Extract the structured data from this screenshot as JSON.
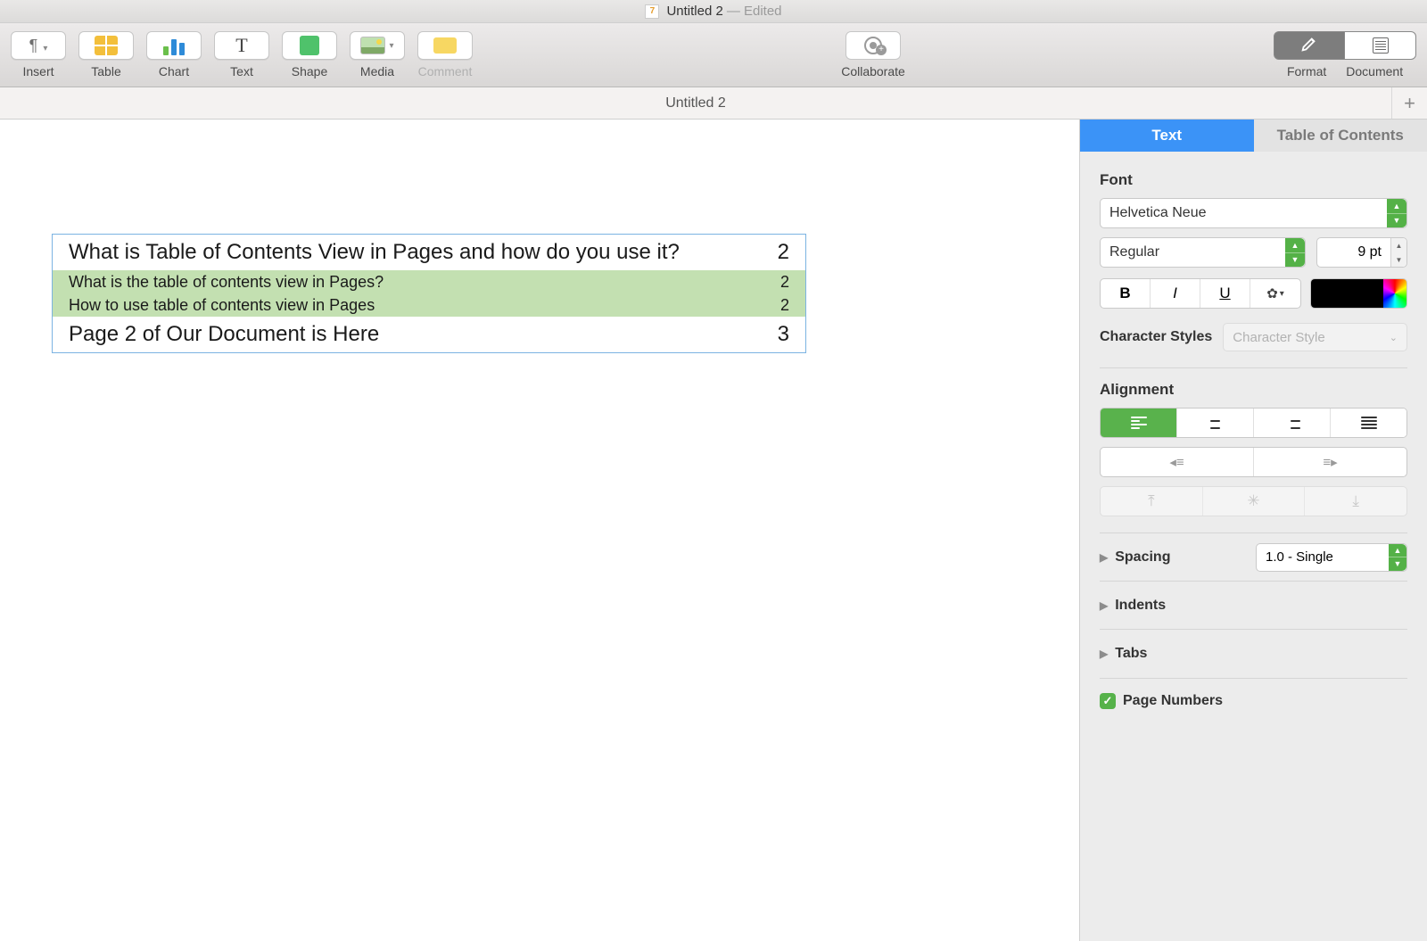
{
  "window": {
    "title": "Untitled 2",
    "status": "— Edited"
  },
  "toolbar": {
    "insert": "Insert",
    "table": "Table",
    "chart": "Chart",
    "text": "Text",
    "shape": "Shape",
    "media": "Media",
    "comment": "Comment",
    "collaborate": "Collaborate",
    "format": "Format",
    "document": "Document"
  },
  "tabs": {
    "current": "Untitled 2"
  },
  "toc": {
    "rows": [
      {
        "title": "What is Table of Contents View in Pages and how do you use it?",
        "page": "2",
        "level": "h"
      },
      {
        "title": "What is the table of contents view in Pages?",
        "page": "2",
        "level": "s"
      },
      {
        "title": "How to use table of contents view in Pages",
        "page": "2",
        "level": "s"
      },
      {
        "title": "Page 2 of Our Document is Here",
        "page": "3",
        "level": "h"
      }
    ]
  },
  "sidebar": {
    "tabs": {
      "text": "Text",
      "toc": "Table of Contents"
    },
    "font_section": "Font",
    "font_family": "Helvetica Neue",
    "font_style": "Regular",
    "font_size": "9 pt",
    "character_styles_label": "Character Styles",
    "character_styles_placeholder": "Character Style",
    "alignment_section": "Alignment",
    "spacing_label": "Spacing",
    "spacing_value": "1.0 - Single",
    "indents_label": "Indents",
    "tabs_label": "Tabs",
    "page_numbers_label": "Page Numbers"
  }
}
